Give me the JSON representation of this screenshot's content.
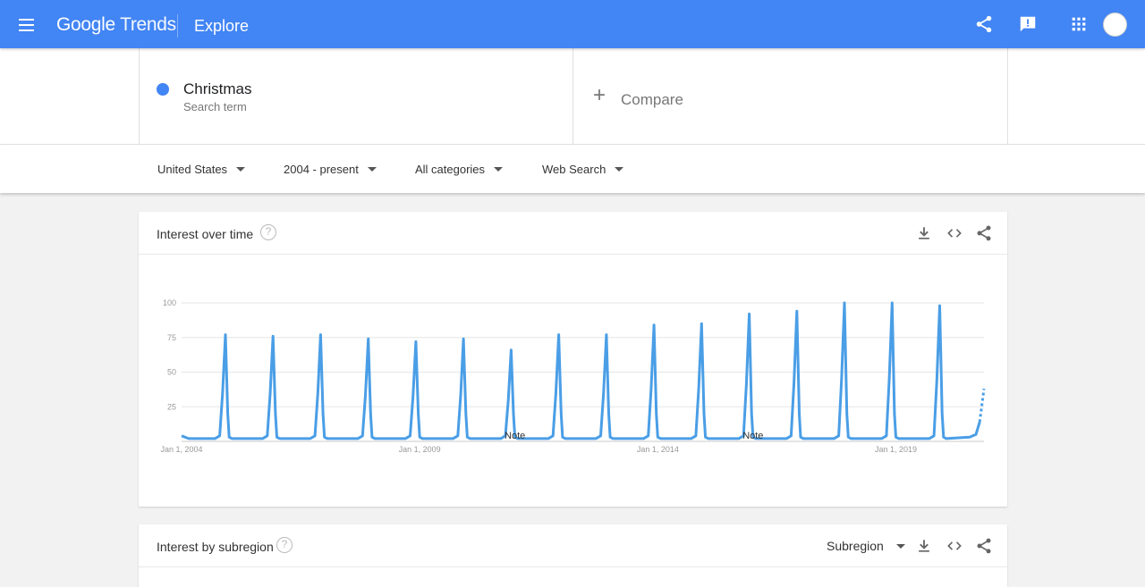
{
  "header": {
    "brand_google": "Google",
    "brand_trends": "Trends",
    "page": "Explore"
  },
  "search": {
    "term": "Christmas",
    "term_type": "Search term",
    "compare_label": "Compare",
    "term_color": "#4285f4"
  },
  "filters": {
    "region": "United States",
    "time": "2004 - present",
    "category": "All categories",
    "property": "Web Search"
  },
  "interest_over_time": {
    "title": "Interest over time"
  },
  "interest_by_subregion": {
    "title": "Interest by subregion",
    "select_value": "Subregion"
  },
  "chart_data": {
    "type": "line",
    "title": "Interest over time",
    "xlabel": "",
    "ylabel": "",
    "ylim": [
      0,
      100
    ],
    "yticks": [
      25,
      50,
      75,
      100
    ],
    "xticks": [
      "Jan 1, 2004",
      "Jan 1, 2009",
      "Jan 1, 2014",
      "Jan 1, 2019"
    ],
    "xrange": [
      2004.0,
      2020.85
    ],
    "grid": true,
    "color": "#4a9ee6",
    "series": [
      {
        "peaks": [
          {
            "year": 2004,
            "value": 77
          },
          {
            "year": 2005,
            "value": 76
          },
          {
            "year": 2006,
            "value": 77
          },
          {
            "year": 2007,
            "value": 74
          },
          {
            "year": 2008,
            "value": 72
          },
          {
            "year": 2009,
            "value": 74
          },
          {
            "year": 2010,
            "value": 66
          },
          {
            "year": 2011,
            "value": 77
          },
          {
            "year": 2012,
            "value": 77
          },
          {
            "year": 2013,
            "value": 84
          },
          {
            "year": 2014,
            "value": 85
          },
          {
            "year": 2015,
            "value": 92
          },
          {
            "year": 2016,
            "value": 94
          },
          {
            "year": 2017,
            "value": 100
          },
          {
            "year": 2018,
            "value": 100
          },
          {
            "year": 2019,
            "value": 98
          }
        ],
        "baseline": 2,
        "partial_end_value": 38
      }
    ],
    "notes": [
      {
        "label": "Note",
        "year": 2011.0
      },
      {
        "label": "Note",
        "year": 2016.0
      }
    ]
  }
}
